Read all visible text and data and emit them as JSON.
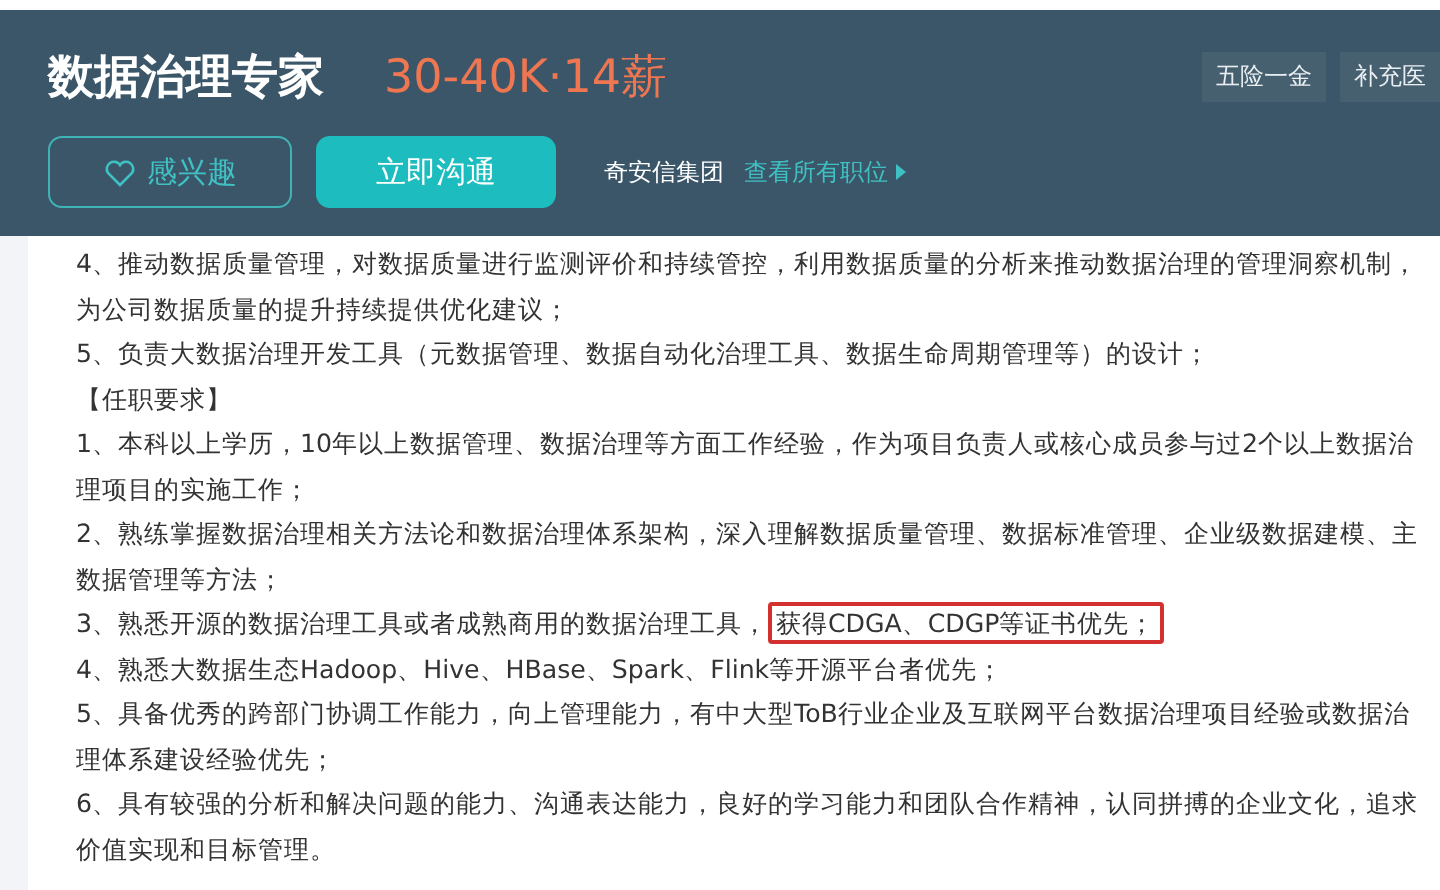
{
  "job": {
    "title": "数据治理专家",
    "salary": "30-40K·14薪",
    "benefits": [
      "五险一金",
      "补充医"
    ]
  },
  "actions": {
    "interest_button": "感兴趣",
    "chat_button": "立即沟通",
    "company": "奇安信集团",
    "all_jobs_link": "查看所有职位"
  },
  "description": [
    {
      "kind": "line",
      "text": "4、推动数据质量管理，对数据质量进行监测评价和持续管控，利用数据质量的分析来推动数据治理的管理洞察机制，为公司数据质量的提升持续提供优化建议；"
    },
    {
      "kind": "line",
      "text": "5、负责大数据治理开发工具（元数据管理、数据自动化治理工具、数据生命周期管理等）的设计；"
    },
    {
      "kind": "heading",
      "text": "【任职要求】"
    },
    {
      "kind": "line",
      "text": "1、本科以上学历，10年以上数据管理、数据治理等方面工作经验，作为项目负责人或核心成员参与过2个以上数据治理项目的实施工作；"
    },
    {
      "kind": "line",
      "text": "2、熟练掌握数据治理相关方法论和数据治理体系架构，深入理解数据质量管理、数据标准管理、企业级数据建模、主数据管理等方法；"
    },
    {
      "kind": "highlighted",
      "text": "3、熟悉开源的数据治理工具或者成熟商用的数据治理工具，",
      "highlight": "获得CDGA、CDGP等证书优先；"
    },
    {
      "kind": "line",
      "text": "4、熟悉大数据生态Hadoop、Hive、HBase、Spark、Flink等开源平台者优先；"
    },
    {
      "kind": "line",
      "text": "5、具备优秀的跨部门协调工作能力，向上管理能力，有中大型ToB行业企业及互联网平台数据治理项目经验或数据治理体系建设经验优先；"
    },
    {
      "kind": "line",
      "text": "6、具有较强的分析和解决问题的能力、沟通表达能力，良好的学习能力和团队合作精神，认同拼搏的企业文化，追求价值实现和目标管理。"
    }
  ]
}
